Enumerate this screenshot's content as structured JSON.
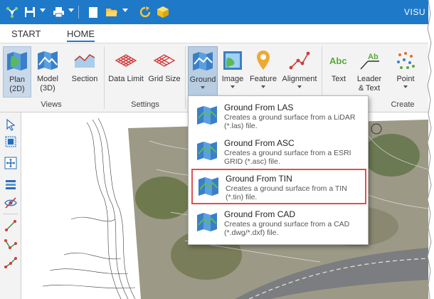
{
  "window": {
    "title": "VISU"
  },
  "tabs": {
    "start": "START",
    "home": "HOME"
  },
  "ribbon": {
    "plan": {
      "line1": "Plan",
      "line2": "(2D)"
    },
    "model": {
      "line1": "Model",
      "line2": "(3D)"
    },
    "section": "Section",
    "data_limit": "Data Limit",
    "grid_size": "Grid Size",
    "ground": "Ground",
    "image": "Image",
    "feature": "Feature",
    "alignment": "Alignment",
    "text": "Text",
    "leader": {
      "line1": "Leader",
      "line2": "& Text"
    },
    "point": "Point",
    "groups": {
      "views": "Views",
      "settings": "Settings",
      "create": "Create"
    }
  },
  "ground_menu": [
    {
      "title": "Ground From LAS",
      "desc": "Creates a ground surface from a LiDAR (*.las) file."
    },
    {
      "title": "Ground From ASC",
      "desc": "Creates a ground surface from a ESRI GRID (*.asc) file."
    },
    {
      "title": "Ground From TIN",
      "desc": "Creates a ground surface from a TIN (*.tin) file."
    },
    {
      "title": "Ground From CAD",
      "desc": "Creates a ground surface from a CAD (*.dwg/*.dxf) file."
    }
  ],
  "colors": {
    "title_bar": "#1e79c8",
    "highlight_border": "#e05050",
    "ribbon_bg": "#f3f3f3"
  },
  "icons": [
    "app-logo-icon",
    "save-icon",
    "print-icon",
    "new-file-icon",
    "open-folder-icon",
    "refresh-icon",
    "cube-icon",
    "map-icon",
    "section-chart-icon",
    "grid-icon",
    "image-icon",
    "location-pin-icon",
    "alignment-icon",
    "text-abc-icon",
    "leader-text-icon",
    "points-icon",
    "select-arrow-icon",
    "select-box-icon",
    "move-icon",
    "layers-icon",
    "hide-eye-icon",
    "line-icon",
    "polyline-icon",
    "polyline-node-icon"
  ]
}
